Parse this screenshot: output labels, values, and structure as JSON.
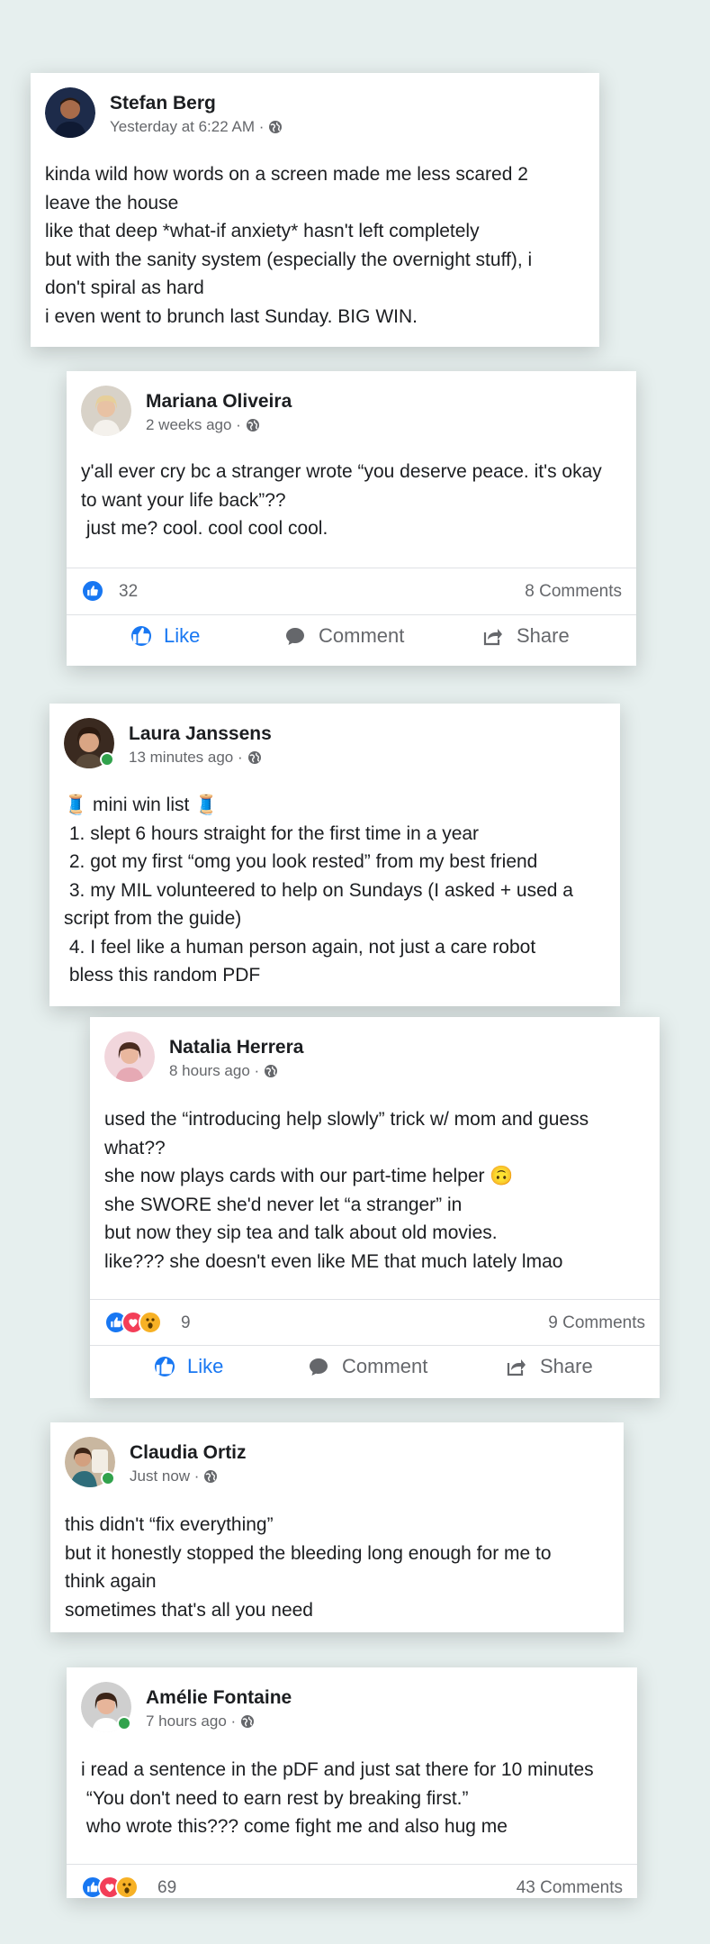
{
  "posts": [
    {
      "name": "Stefan Berg",
      "time": "Yesterday at 6:22 AM ·",
      "text": "kinda wild how words on a screen made me less scared 2\nleave the house\nlike that deep *what-if anxiety* hasn't left completely\nbut with the sanity system (especially the overnight stuff), i\ndon't spiral as hard\ni even went to brunch last Sunday. BIG WIN."
    },
    {
      "name": "Mariana Oliveira",
      "time": "2 weeks ago ·",
      "text": "y'all ever cry bc a stranger wrote “you deserve peace. it's okay\nto want your life back”??\n just me? cool. cool cool cool.",
      "reaction_count": "32",
      "comments": "8 Comments"
    },
    {
      "name": "Laura Janssens",
      "time": "13 minutes ago ·",
      "text": "🧵 mini win list 🧵\n 1. slept 6 hours straight for the first time in a year\n 2. got my first “omg you look rested” from my best friend\n 3. my MIL volunteered to help on Sundays (I asked + used a\nscript from the guide)\n 4. I feel like a human person again, not just a care robot\n bless this random PDF"
    },
    {
      "name": "Natalia Herrera",
      "time": "8 hours ago ·",
      "text": "used the “introducing help slowly” trick w/ mom and guess\nwhat??\nshe now plays cards with our part-time helper 🙃\nshe SWORE she'd never let “a stranger” in\nbut now they sip tea and talk about old movies.\nlike??? she doesn't even like ME that much lately lmao",
      "reaction_count": "9",
      "comments": "9 Comments"
    },
    {
      "name": "Claudia Ortiz",
      "time": "Just now ·",
      "text": "this didn't “fix everything”\nbut it honestly stopped the bleeding long enough for me to\nthink again\nsometimes that's all you need"
    },
    {
      "name": "Amélie Fontaine",
      "time": "7 hours ago ·",
      "text": "i read a sentence in the pDF and just sat there for 10 minutes\n “You don't need to earn rest by breaking first.”\n who wrote this??? come fight me and also hug me",
      "reaction_count": "69",
      "comments": "43 Comments"
    }
  ],
  "actions": {
    "like": "Like",
    "comment": "Comment",
    "share": "Share"
  },
  "icons": {
    "globe": "globe-icon",
    "like": "thumbs-up-icon",
    "love": "heart-icon",
    "wow": "wow-icon",
    "comment": "comment-bubble-icon",
    "share": "share-arrow-icon"
  },
  "colors": {
    "like_blue": "#1877f2",
    "love_red": "#f33e58",
    "wow_yellow": "#f7b125",
    "online_green": "#31a24c",
    "background": "#e6efee"
  }
}
